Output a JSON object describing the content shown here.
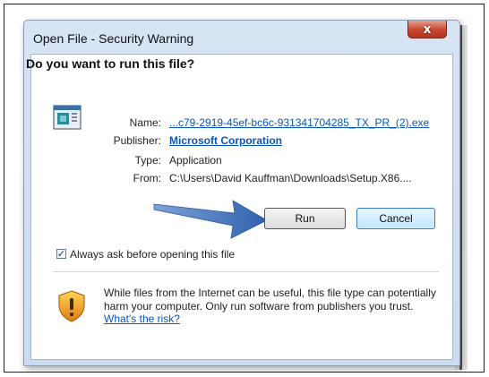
{
  "dialog": {
    "title": "Open File - Security Warning",
    "close_label": "x",
    "question": "Do you want to run this file?",
    "fields": {
      "name_label": "Name:",
      "name_value": "...c79-2919-45ef-bc6c-931341704285_TX_PR_(2).exe",
      "publisher_label": "Publisher:",
      "publisher_value": "Microsoft Corporation",
      "type_label": "Type:",
      "type_value": "Application",
      "from_label": "From:",
      "from_value": "C:\\Users\\David Kauffman\\Downloads\\Setup.X86...."
    },
    "buttons": {
      "run": "Run",
      "cancel": "Cancel"
    },
    "checkbox": {
      "label": "Always ask before opening this file",
      "checked": true
    },
    "warning": {
      "text": "While files from the Internet can be useful, this file type can potentially harm your computer. Only run software from publishers you trust.",
      "link": "What's the risk?"
    }
  },
  "colors": {
    "link": "#0a56b8",
    "arrow": "#3d6fb6",
    "close_button": "#c8452e",
    "shield": "#f0a020"
  },
  "icons": [
    "application-file-icon",
    "close-icon",
    "checkmark-icon",
    "shield-warning-icon",
    "arrow-pointer-icon"
  ]
}
